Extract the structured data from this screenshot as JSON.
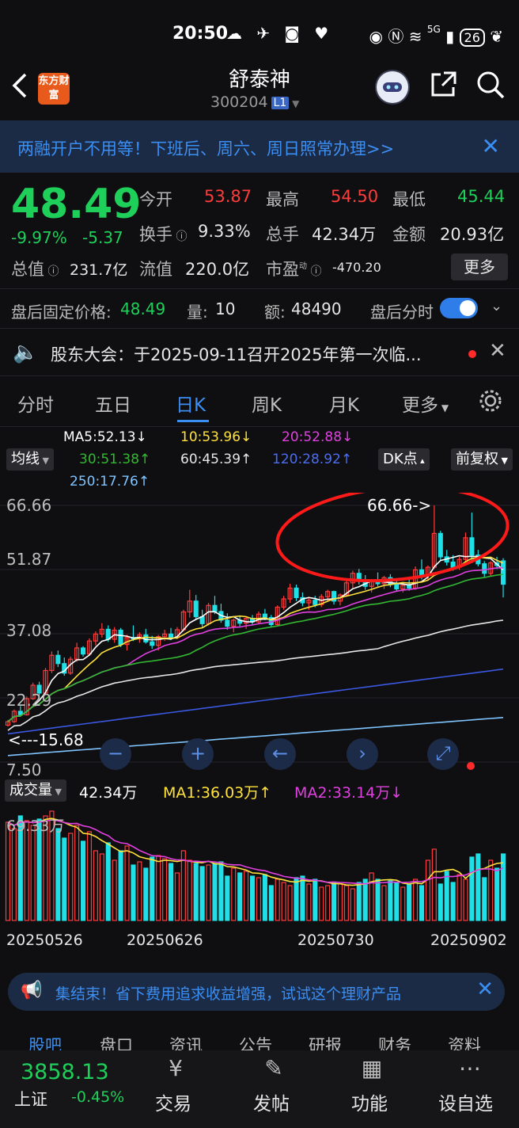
{
  "status_bar": {
    "time": "20:50",
    "network": "5G",
    "battery": "26"
  },
  "header": {
    "stock_name": "舒泰神",
    "stock_code": "300204",
    "level": "L1",
    "logo_text": "东方财富"
  },
  "banner": {
    "text": "两融开户不用等！下班后、周六、周日照常办理>>"
  },
  "quote": {
    "price": "48.49",
    "change_pct": "-9.97%",
    "change_amt": "-5.37",
    "open_label": "今开",
    "open": "53.87",
    "high_label": "最高",
    "high": "54.50",
    "low_label": "最低",
    "low": "45.44",
    "turnover_label": "换手",
    "turnover": "9.33%",
    "volume_label": "总手",
    "volume": "42.34万",
    "amount_label": "金额",
    "amount": "20.93亿",
    "mktcap_label": "总值",
    "mktcap": "231.7亿",
    "float_label": "流值",
    "float": "220.0亿",
    "pe_label": "市盈",
    "pe_sup": "动",
    "pe": "-470.20",
    "more_button": "更多"
  },
  "after_hours": {
    "fixed_price_label": "盘后固定价格:",
    "fixed_price": "48.49",
    "qty_label": "量:",
    "qty": "10",
    "amt_label": "额:",
    "amt": "48490",
    "timeshare_label": "盘后分时"
  },
  "notice": {
    "text": "股东大会：于2025-09-11召开2025年第一次临..."
  },
  "tabs": [
    "分时",
    "五日",
    "日K",
    "周K",
    "月K",
    "更多"
  ],
  "active_tab": "日K",
  "ma_legend": {
    "selector": "均线",
    "ma5": "MA5:52.13↓",
    "ma10": "10:53.96↓",
    "ma20": "20:52.88↓",
    "ma30": "30:51.38↑",
    "ma60": "60:45.39↑",
    "ma120": "120:28.92↑",
    "ma250": "250:17.76↑",
    "dk_button": "DK点",
    "adjust_button": "前复权"
  },
  "colors": {
    "up": "#ff3b3b",
    "down": "#1ee0e6",
    "ma5": "#ffffff",
    "ma10": "#ffe23c",
    "ma20": "#e040e0",
    "ma30": "#33b833",
    "ma60": "#e6e6e6",
    "ma120": "#3a58e0",
    "ma250": "#7fc4ff",
    "accent": "#3b8ef2",
    "price_down": "#1ed05a"
  },
  "chart_data": [
    {
      "type": "candlestick",
      "y_axis_labels": [
        "66.66",
        "51.87",
        "37.08",
        "22.29",
        "7.50"
      ],
      "ylim": [
        7.5,
        66.66
      ],
      "annotations": {
        "max": "66.66->",
        "min": "<---15.68"
      },
      "candles": [
        [
          16.0,
          17.2,
          15.68,
          16.8
        ],
        [
          16.8,
          19.6,
          16.5,
          19.2
        ],
        [
          19.2,
          20.4,
          18.0,
          18.4
        ],
        [
          18.4,
          22.6,
          18.2,
          22.1
        ],
        [
          22.1,
          25.8,
          21.8,
          25.2
        ],
        [
          25.2,
          26.0,
          22.8,
          23.4
        ],
        [
          23.4,
          29.2,
          23.0,
          28.6
        ],
        [
          28.6,
          33.0,
          28.0,
          32.1
        ],
        [
          32.1,
          33.2,
          29.4,
          30.2
        ],
        [
          30.2,
          31.6,
          27.4,
          28.0
        ],
        [
          28.0,
          31.8,
          27.6,
          31.2
        ],
        [
          31.2,
          35.0,
          30.6,
          33.8
        ],
        [
          33.8,
          34.2,
          31.8,
          32.4
        ],
        [
          32.4,
          36.0,
          32.0,
          35.4
        ],
        [
          35.4,
          37.6,
          34.4,
          37.0
        ],
        [
          37.0,
          39.5,
          36.2,
          38.1
        ],
        [
          38.1,
          39.0,
          35.2,
          35.8
        ],
        [
          35.8,
          38.6,
          35.0,
          37.9
        ],
        [
          37.9,
          38.4,
          34.0,
          34.6
        ],
        [
          34.6,
          36.8,
          33.2,
          36.2
        ],
        [
          36.2,
          39.0,
          35.4,
          35.9
        ],
        [
          35.9,
          37.4,
          35.0,
          36.8
        ],
        [
          36.8,
          38.2,
          34.8,
          35.2
        ],
        [
          35.2,
          36.6,
          33.6,
          34.4
        ],
        [
          34.4,
          36.8,
          33.2,
          36.4
        ],
        [
          36.4,
          38.0,
          35.4,
          37.0
        ],
        [
          37.0,
          38.4,
          35.6,
          36.2
        ],
        [
          36.2,
          38.6,
          35.8,
          38.0
        ],
        [
          38.0,
          42.6,
          37.6,
          42.1
        ],
        [
          42.1,
          47.2,
          40.8,
          44.6
        ],
        [
          44.6,
          46.0,
          40.2,
          41.0
        ],
        [
          41.0,
          42.6,
          38.6,
          39.4
        ],
        [
          39.4,
          44.2,
          39.0,
          43.6
        ],
        [
          43.6,
          45.8,
          41.6,
          42.2
        ],
        [
          42.2,
          44.0,
          39.6,
          40.2
        ],
        [
          40.2,
          41.8,
          38.0,
          38.8
        ],
        [
          38.8,
          40.6,
          37.4,
          40.2
        ],
        [
          40.2,
          41.2,
          38.8,
          39.5
        ],
        [
          39.5,
          41.0,
          38.2,
          40.6
        ],
        [
          40.6,
          41.4,
          39.2,
          39.8
        ],
        [
          39.8,
          42.2,
          39.4,
          41.6
        ],
        [
          41.6,
          42.8,
          40.2,
          40.8
        ],
        [
          40.8,
          41.4,
          38.6,
          39.2
        ],
        [
          39.2,
          43.6,
          39.0,
          43.2
        ],
        [
          43.2,
          45.8,
          42.6,
          45.1
        ],
        [
          45.1,
          48.6,
          44.2,
          47.6
        ],
        [
          47.6,
          48.4,
          44.6,
          45.4
        ],
        [
          45.4,
          46.6,
          43.4,
          44.2
        ],
        [
          44.2,
          45.2,
          42.6,
          44.8
        ],
        [
          44.8,
          45.8,
          43.2,
          43.8
        ],
        [
          43.8,
          46.2,
          43.2,
          45.6
        ],
        [
          45.6,
          47.2,
          44.6,
          46.8
        ],
        [
          46.8,
          47.0,
          43.8,
          44.6
        ],
        [
          44.6,
          46.4,
          43.6,
          46.0
        ],
        [
          46.0,
          49.4,
          45.6,
          48.8
        ],
        [
          48.8,
          51.6,
          47.6,
          51.0
        ],
        [
          51.0,
          52.0,
          48.4,
          49.2
        ],
        [
          49.2,
          50.6,
          47.2,
          48.0
        ],
        [
          48.0,
          49.6,
          46.6,
          49.2
        ],
        [
          49.2,
          51.2,
          48.0,
          48.6
        ],
        [
          48.6,
          50.4,
          47.4,
          50.0
        ],
        [
          50.0,
          50.8,
          47.8,
          48.4
        ],
        [
          48.4,
          49.6,
          46.8,
          47.4
        ],
        [
          47.4,
          48.8,
          46.6,
          48.2
        ],
        [
          48.2,
          49.8,
          47.0,
          47.6
        ],
        [
          47.6,
          52.6,
          47.2,
          51.8
        ],
        [
          51.8,
          54.2,
          49.6,
          50.6
        ],
        [
          50.6,
          52.8,
          49.4,
          52.4
        ],
        [
          52.4,
          66.66,
          52.0,
          60.2
        ],
        [
          60.2,
          60.8,
          53.8,
          54.8
        ],
        [
          54.8,
          56.4,
          52.8,
          53.6
        ],
        [
          53.6,
          55.2,
          51.6,
          52.4
        ],
        [
          52.4,
          54.8,
          51.8,
          54.2
        ],
        [
          54.2,
          60.4,
          53.8,
          59.2
        ],
        [
          59.2,
          65.0,
          54.0,
          55.2
        ],
        [
          55.2,
          56.4,
          52.6,
          53.2
        ],
        [
          53.2,
          53.8,
          50.2,
          51.0
        ],
        [
          51.0,
          53.8,
          50.4,
          53.4
        ],
        [
          53.4,
          54.8,
          52.0,
          52.8
        ],
        [
          53.87,
          54.5,
          45.44,
          48.49
        ]
      ]
    },
    {
      "type": "bar",
      "title": "成交量",
      "current": "42.34万",
      "ma1": "MA1:36.03万↑",
      "ma2": "MA2:33.14万↓",
      "y_axis_label": "69.33万",
      "x_labels": [
        "20250526",
        "20250626",
        "20250730",
        "20250902"
      ],
      "values": [
        62,
        58,
        66,
        63,
        60,
        64,
        66,
        69,
        58,
        52,
        55,
        60,
        50,
        56,
        44,
        42,
        49,
        38,
        44,
        47,
        35,
        37,
        33,
        40,
        41,
        39,
        36,
        30,
        44,
        38,
        36,
        34,
        35,
        36,
        37,
        28,
        33,
        30,
        31,
        28,
        27,
        29,
        22,
        26,
        24,
        22,
        27,
        28,
        23,
        26,
        21,
        22,
        24,
        23,
        22,
        20,
        24,
        26,
        30,
        26,
        22,
        25,
        24,
        21,
        23,
        26,
        22,
        38,
        45,
        23,
        31,
        24,
        29,
        26,
        40,
        42,
        27,
        38,
        33,
        42
      ],
      "ylim": [
        0,
        70
      ]
    }
  ],
  "ad": {
    "text": "集结束！省下费用追求收益增强，试试这个理财产品"
  },
  "subtabs": [
    "股吧",
    "盘口",
    "资讯",
    "公告",
    "研报",
    "财务",
    "资料"
  ],
  "bottom_nav": {
    "index_value": "3858.13",
    "index_name": "上证",
    "index_change": "-0.45%",
    "items": [
      "交易",
      "发帖",
      "功能",
      "设自选"
    ]
  }
}
